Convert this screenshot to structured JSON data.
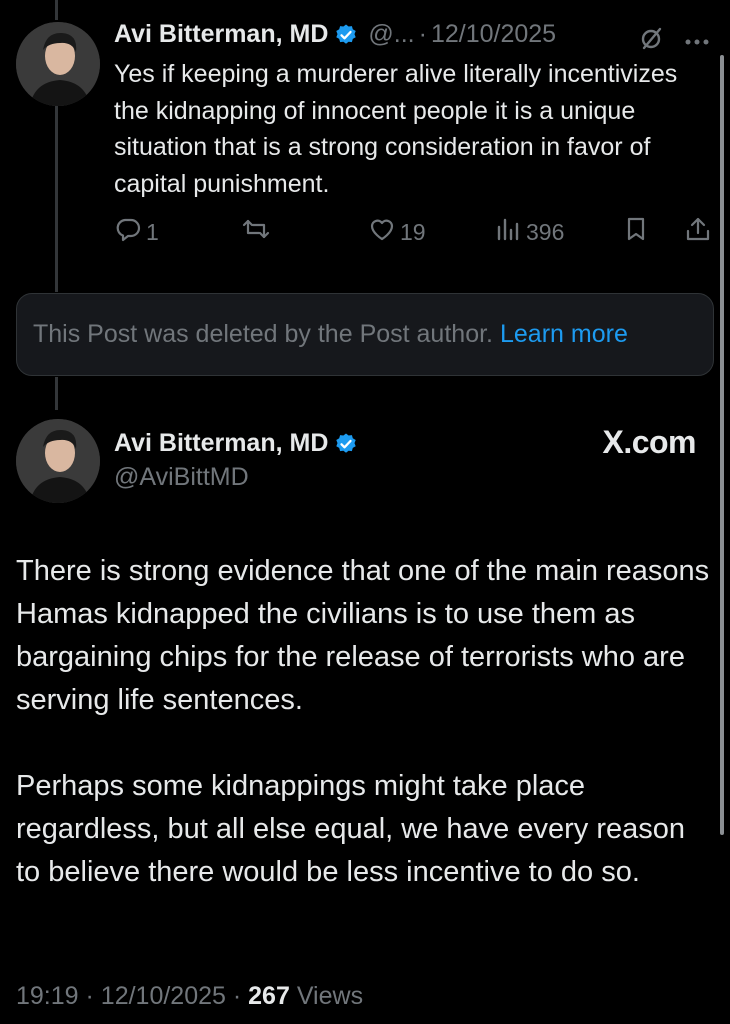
{
  "reply": {
    "author_name": "Avi Bitterman, MD",
    "handle_truncated": "@...",
    "date": "12/10/2025",
    "text": "Yes if keeping a murderer alive literally incentivizes the kidnapping of innocent people it is a unique situation that is a strong consideration in favor of capital punishment.",
    "reply_count": "1",
    "like_count": "19",
    "view_count": "396"
  },
  "deleted_notice": {
    "text": "This Post was deleted by the Post author.",
    "link_label": "Learn more"
  },
  "quoted_post": {
    "author_name": "Avi Bitterman, MD",
    "handle": "@AviBittMD",
    "source_label": "X.com",
    "paragraphs": [
      "There is strong evidence that one of the main reasons Hamas kidnapped the civilians is to use them as bargaining chips for the release of terrorists who are serving life sentences.",
      "Perhaps some kidnappings might take place regardless, but all else equal, we have every reason to believe there would be less incentive to do so."
    ],
    "time": "19:19",
    "date": "12/10/2025",
    "views_count": "267",
    "views_label": "Views"
  },
  "colors": {
    "background": "#000000",
    "text_primary": "#e7e9ea",
    "text_muted": "#71767b",
    "link": "#1d9bf0",
    "verified_badge": "#1d9bf0"
  },
  "icons": [
    "verified-badge-icon",
    "grok-icon",
    "more-icon",
    "reply-icon",
    "repost-icon",
    "like-icon",
    "views-icon",
    "bookmark-icon",
    "share-icon"
  ]
}
